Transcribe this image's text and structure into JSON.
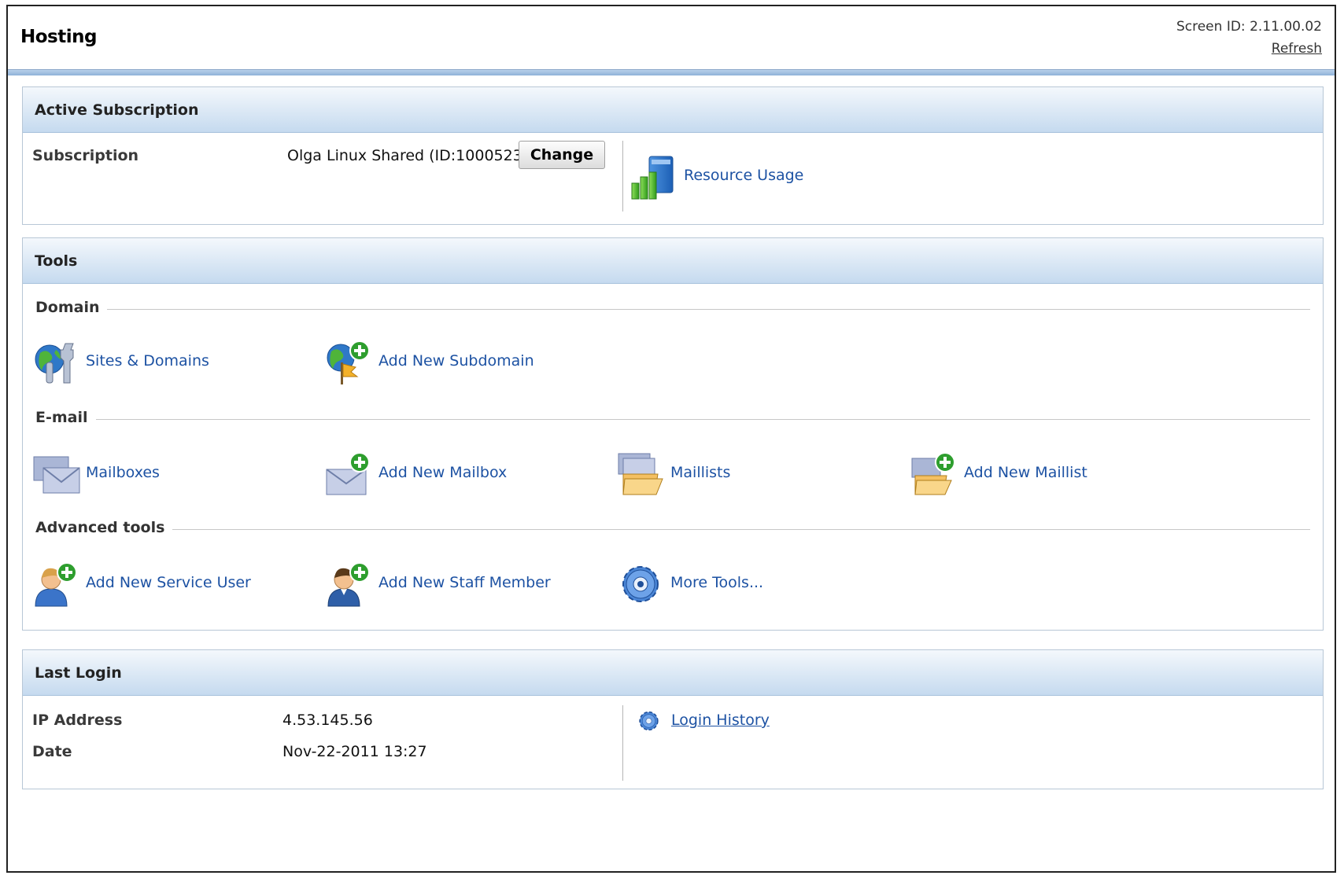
{
  "header": {
    "title": "Hosting",
    "screen_id_label": "Screen ID:",
    "screen_id_value": "2.11.00.02",
    "refresh_label": "Refresh"
  },
  "active_subscription": {
    "title": "Active Subscription",
    "subscription_label": "Subscription",
    "subscription_value": "Olga Linux Shared (ID:1000523)",
    "change_button": "Change",
    "resource_usage": {
      "label": "Resource Usage",
      "icon": "bar-chart-icon"
    }
  },
  "tools": {
    "title": "Tools",
    "groups": [
      {
        "title": "Domain",
        "items": [
          {
            "label": "Sites & Domains",
            "icon": "globe-wrench-icon"
          },
          {
            "label": "Add New Subdomain",
            "icon": "globe-flag-add-icon"
          }
        ]
      },
      {
        "title": "E-mail",
        "items": [
          {
            "label": "Mailboxes",
            "icon": "envelopes-icon"
          },
          {
            "label": "Add New Mailbox",
            "icon": "envelope-add-icon"
          },
          {
            "label": "Maillists",
            "icon": "envelope-folder-icon"
          },
          {
            "label": "Add New Maillist",
            "icon": "envelope-folder-add-icon"
          }
        ]
      },
      {
        "title": "Advanced tools",
        "items": [
          {
            "label": "Add New Service User",
            "icon": "user-add-icon"
          },
          {
            "label": "Add New Staff Member",
            "icon": "staff-add-icon"
          },
          {
            "label": "More Tools...",
            "icon": "gear-icon"
          }
        ]
      }
    ]
  },
  "last_login": {
    "title": "Last Login",
    "ip_label": "IP Address",
    "ip_value": "4.53.145.56",
    "date_label": "Date",
    "date_value": "Nov-22-2011 13:27",
    "history_link": {
      "label": "Login History",
      "icon": "gear-icon"
    }
  },
  "colors": {
    "link": "#1d52a3",
    "header_gradient_bottom": "#c5daef",
    "add_badge": "#2e9e2e"
  }
}
